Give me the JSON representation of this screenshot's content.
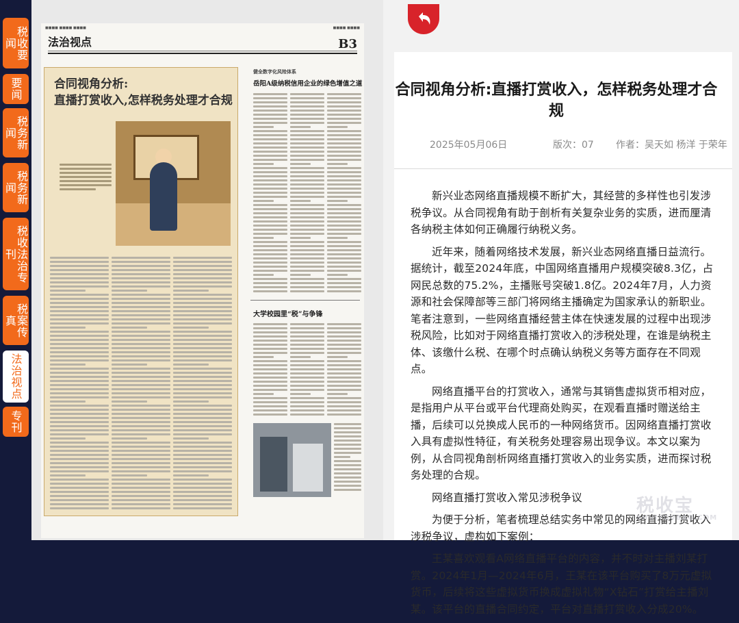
{
  "sidebar": {
    "tabs": [
      {
        "label": "税收要闻",
        "active": false
      },
      {
        "label": "要闻",
        "active": false
      },
      {
        "label": "税务新闻",
        "active": false
      },
      {
        "label": "税务新闻",
        "active": false
      },
      {
        "label": "税收法治专刊",
        "active": false
      },
      {
        "label": "税案传真",
        "active": false
      },
      {
        "label": "法治视点",
        "active": true
      },
      {
        "label": "专刊",
        "active": false
      }
    ]
  },
  "newspaper": {
    "section": "法治视点",
    "page_number": "B3",
    "headline": "合同视角分析:\n直播打赏收入,怎样税务处理才合规",
    "side_headline": "岳阳A级纳税信用企业的绿色增值之道",
    "side_kicker": "健全数字化风险体系",
    "school_headline": "大学校园里“税”与争锋"
  },
  "article": {
    "title": "合同视角分析:直播打赏收入，怎样税务处理才合规",
    "date": "2025年05月06日",
    "edition": "版次：07",
    "authors": "作者：吴天如 杨洋 于荣年",
    "paragraphs": [
      "新兴业态网络直播规模不断扩大，其经营的多样性也引发涉税争议。从合同视角有助于剖析有关复杂业务的实质，进而厘清各纳税主体如何正确履行纳税义务。",
      "近年来，随着网络技术发展，新兴业态网络直播日益流行。据统计，截至2024年底，中国网络直播用户规模突破8.3亿，占网民总数的75.2%，主播账号突破1.8亿。2024年7月，人力资源和社会保障部等三部门将网络主播确定为国家承认的新职业。笔者注意到，一些网络直播经营主体在快速发展的过程中出现涉税风险，比如对于网络直播打赏收入的涉税处理，在谁是纳税主体、该缴什么税、在哪个时点确认纳税义务等方面存在不同观点。",
      "网络直播平台的打赏收入，通常与其销售虚拟货币相对应，是指用户从平台或平台代理商处购买，在观看直播时赠送给主播，后续可以兑换成人民币的一种网络货币。因网络直播打赏收入具有虚拟性特征，有关税务处理容易出现争议。本文以案为例，从合同视角剖析网络直播打赏收入的业务实质，进而探讨税务处理的合规。",
      "网络直播打赏收入常见涉税争议",
      "为便于分析，笔者梳理总结实务中常见的网络直播打赏收入涉税争议，虚构如下案例：",
      "王某喜欢观看A网络直播平台的内容，并不时对主播刘某打赏。2024年1月—2024年6月，王某在该平台购买了8万元虚拟货币，后续将这些虚拟货币换成虚拟礼物“X钻石”打赏给主播刘某。该平台的直播合同约定，平台对直播打赏收入分成20%。"
    ]
  },
  "watermark": {
    "text": "税收宝",
    "sub": "SHUIYOUBAO.COM"
  },
  "colors": {
    "tab_orange": "#f26a1b",
    "back_red": "#d8232a",
    "navy": "#141a3a"
  }
}
